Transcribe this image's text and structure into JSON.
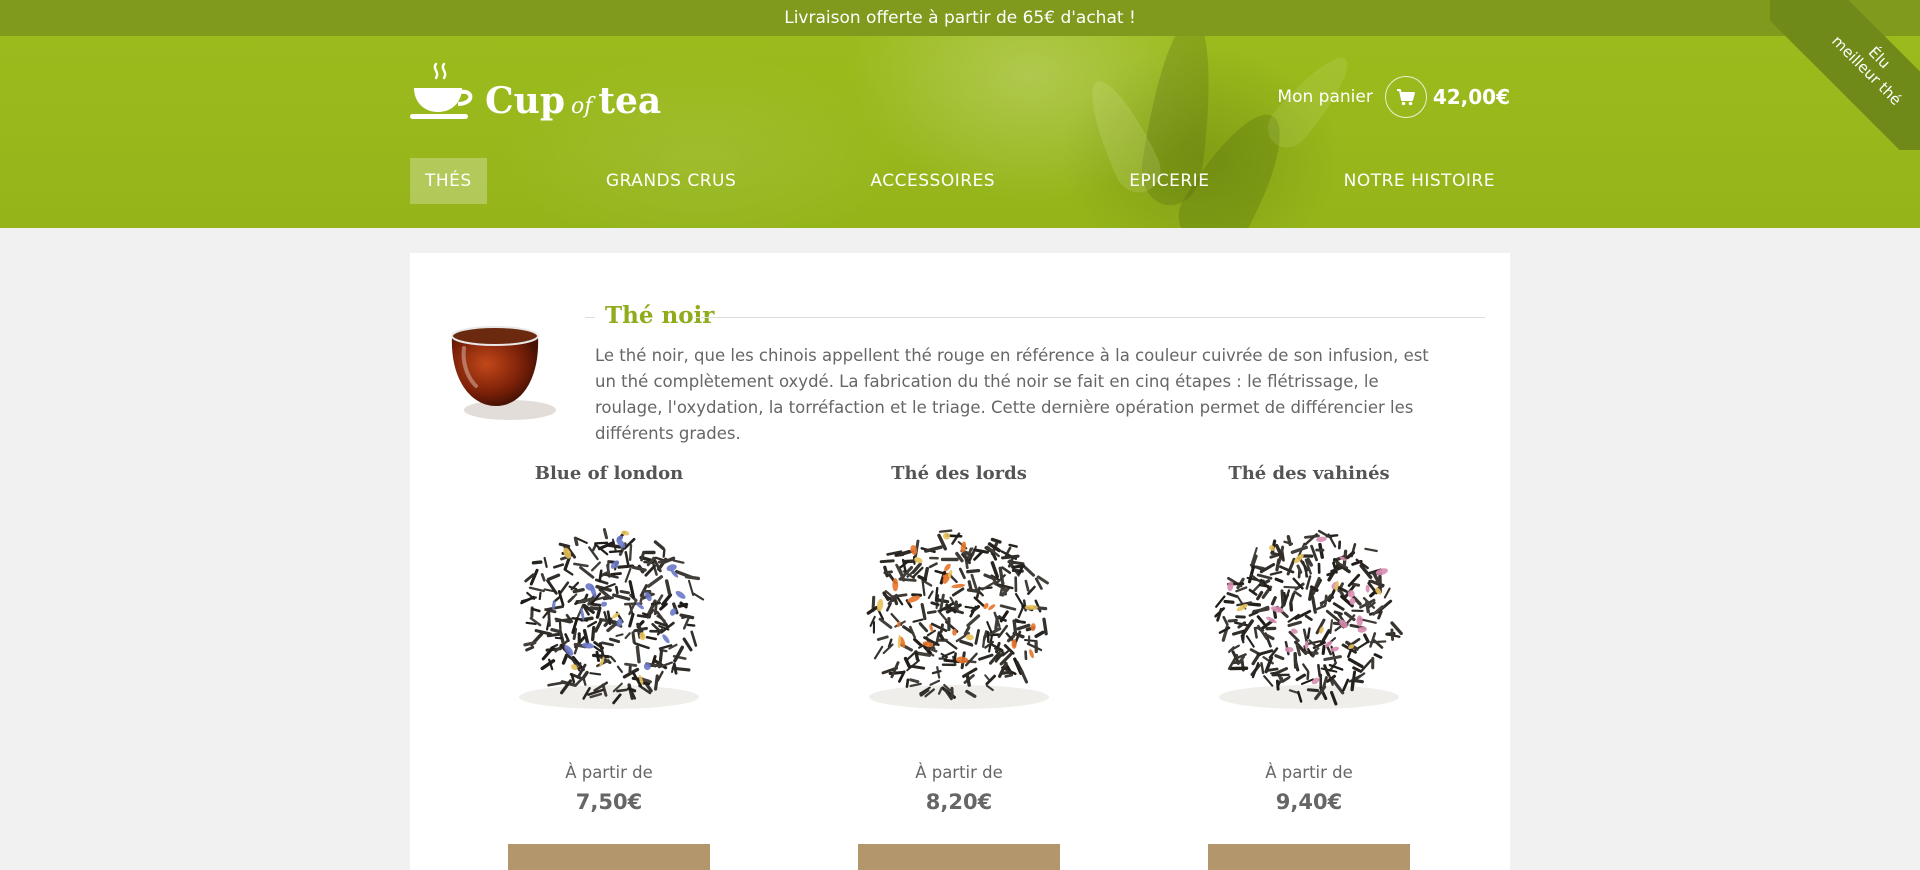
{
  "topbar": {
    "shipping_notice": "Livraison offerte à partir de 65€ d'achat !"
  },
  "ribbon": {
    "line1": "Élu",
    "line2": "meilleur thé"
  },
  "logo": {
    "word1": "Cup",
    "word2": "of",
    "word3": "tea"
  },
  "cart": {
    "label": "Mon panier",
    "total": "42,00€",
    "icon": "cart-icon"
  },
  "nav": {
    "items": [
      {
        "label": "THÉS",
        "active": true
      },
      {
        "label": "GRANDS CRUS",
        "active": false
      },
      {
        "label": "ACCESSOIRES",
        "active": false
      },
      {
        "label": "EPICERIE",
        "active": false
      },
      {
        "label": "NOTRE HISTOIRE",
        "active": false
      }
    ]
  },
  "section": {
    "title": "Thé noir",
    "description": "Le thé noir, que les chinois appellent thé rouge en référence à la couleur cuivrée de son infusion, est un thé complètement oxydé. La fabrication du thé noir se fait en cinq étapes : le flétrissage, le roulage, l'oxydation, la torréfaction et le triage. Cette dernière opération permet de différencier les différents grades."
  },
  "products": [
    {
      "name": "Blue of london",
      "from": "À partir de",
      "price": "7,50€",
      "accent": "#6a78c8"
    },
    {
      "name": "Thé des lords",
      "from": "À partir de",
      "price": "8,20€",
      "accent": "#e8742a"
    },
    {
      "name": "Thé des vahinés",
      "from": "À partir de",
      "price": "9,40€",
      "accent": "#d98cb0"
    }
  ],
  "colors": {
    "brand_green": "#9bbb1d",
    "title_green": "#8fac1c",
    "button_tan": "#b3966c"
  }
}
